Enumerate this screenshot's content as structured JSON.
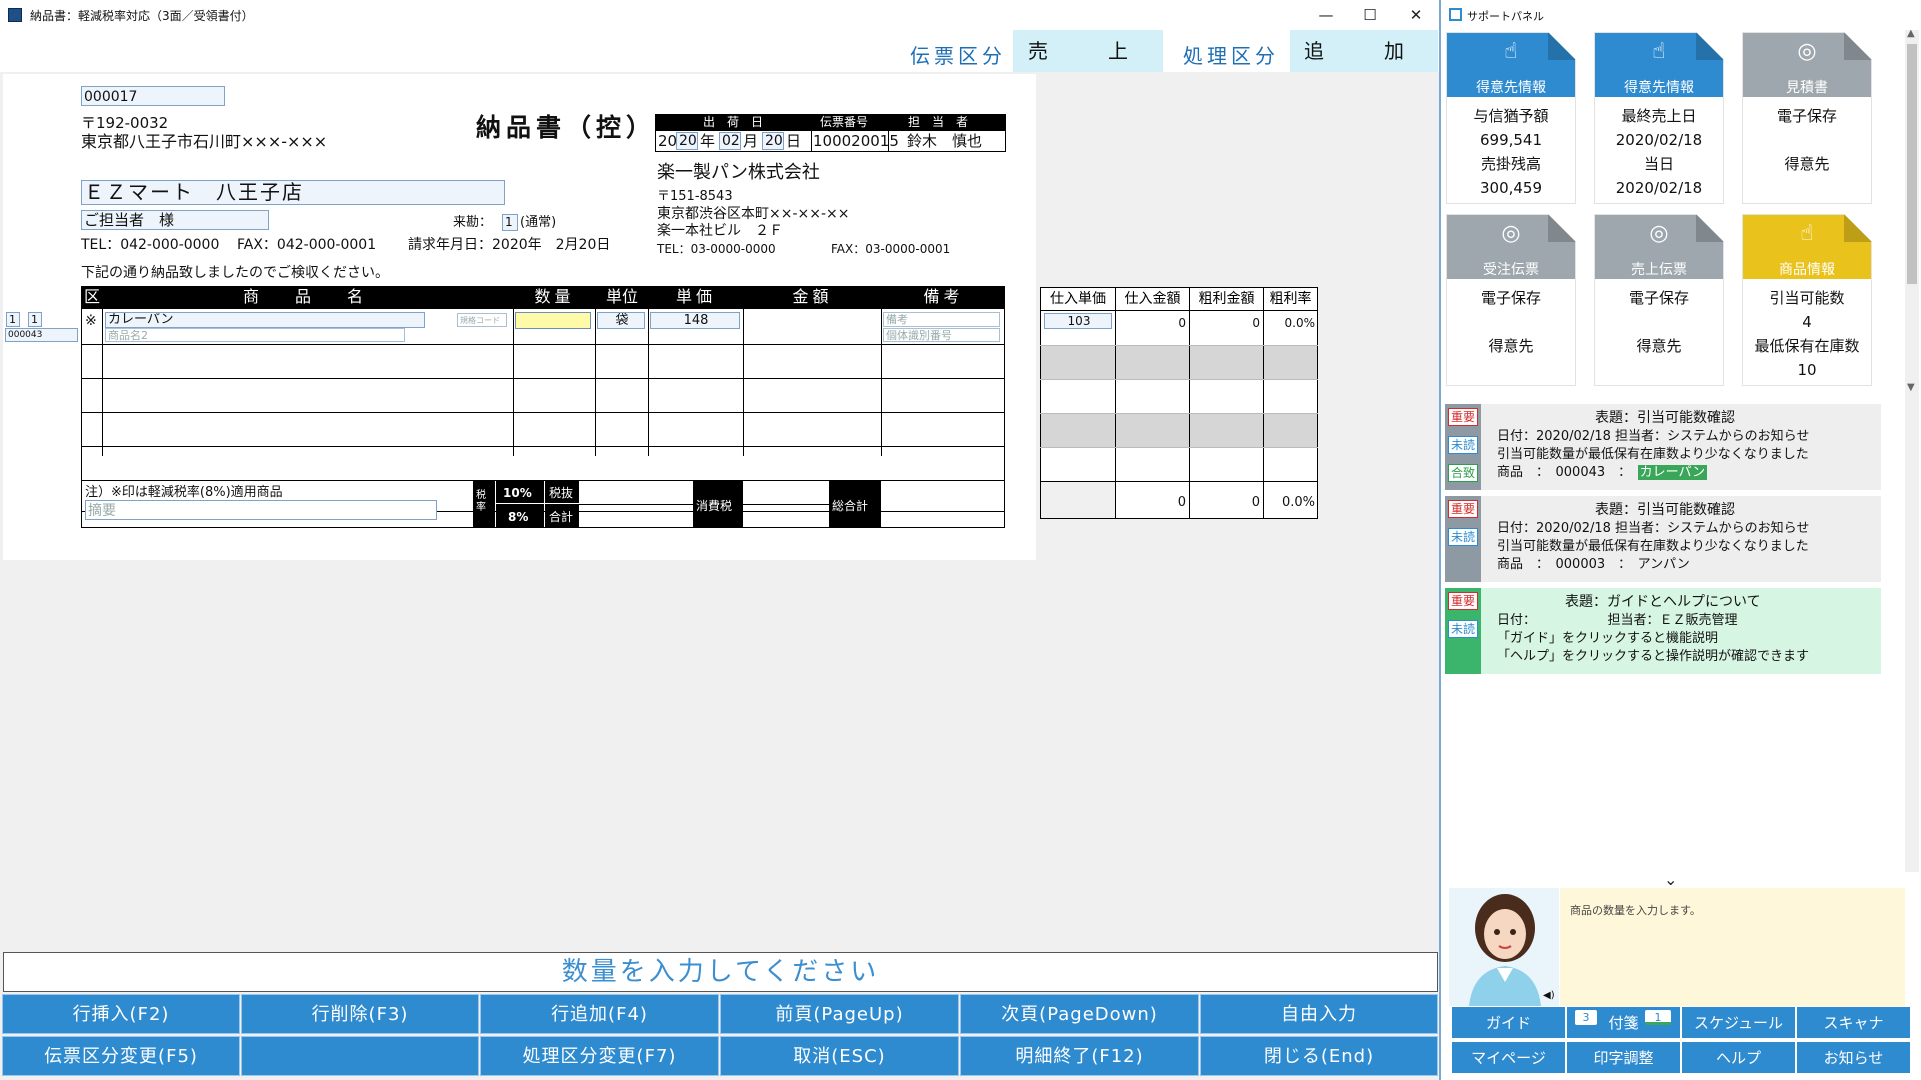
{
  "window": {
    "title": "納品書：軽減税率対応（3面／受領書付）",
    "minimize": "—",
    "maximize": "☐",
    "close": "✕"
  },
  "header": {
    "denpyo_label": "伝票区分",
    "denpyo_value": "売　上",
    "shori_label": "処理区分",
    "shori_value": "追　加"
  },
  "doc": {
    "customer_code": "000017",
    "zip": "〒192-0032",
    "address": "東京都八王子市石川町×××-×××",
    "title": "納品書（控）",
    "ship_date_label": "出　荷　日",
    "slip_no_label": "伝票番号",
    "staff_label": "担　当　者",
    "date_y1": "20",
    "date_y2": "20",
    "date_y_unit": "年",
    "date_m": "02",
    "date_m_unit": "月",
    "date_d": "20",
    "date_d_unit": "日",
    "slip_no": "100020015",
    "staff": "鈴木　慎也",
    "company": "楽一製パン株式会社",
    "company_zip": "〒151-8543",
    "company_address": "東京都渋谷区本町××-××-××",
    "company_building": "楽一本社ビル　２Ｆ",
    "company_tel": "TEL：03-0000-0000",
    "company_fax": "FAX：03-0000-0001",
    "customer_name": "ＥＺマート　八王子店",
    "contact": "ご担当者　様",
    "raikin_label": "来勘：",
    "raikin_value": "1",
    "raikin_text": "(通常)",
    "tel": "TEL：042-000-0000",
    "fax": "FAX：042-000-0001",
    "billing": "請求年月日：2020年　2月20日",
    "notice": "下記の通り納品致しましたのでご検収ください。"
  },
  "table": {
    "headers": [
      "区",
      "商　品　名",
      "数量",
      "単位",
      "単価",
      "金額",
      "備考"
    ],
    "row1": {
      "kubun": "※",
      "name": "カレーパン",
      "name2": "商品名2",
      "code_ph": "規格コード",
      "unit": "袋",
      "price": "148",
      "biko": "備考",
      "biko2": "個体識別番号"
    },
    "side_a": "1",
    "side_b": "1",
    "side_code": "000043",
    "note": "注）※印は軽減税率(8%)適用商品",
    "memo_ph": "摘要",
    "tax_label": "税率",
    "rate10": "10%",
    "rate8": "8%",
    "zeinuki": "税抜",
    "gokei": "合計",
    "shohizei": "消費税",
    "sougokei": "総合計"
  },
  "profit": {
    "headers": [
      "仕入単価",
      "仕入金額",
      "粗利金額",
      "粗利率"
    ],
    "row1": [
      "103",
      "0",
      "0",
      "0.0%"
    ],
    "totals": [
      "0",
      "0",
      "0.0%"
    ]
  },
  "message": "数量を入力してください",
  "fkeys": [
    "行挿入(F2)",
    "行削除(F3)",
    "行追加(F4)",
    "前頁(PageUp)",
    "次頁(PageDown)",
    "自由入力",
    "伝票区分変更(F5)",
    "",
    "処理区分変更(F7)",
    "取消(ESC)",
    "明細終了(F12)",
    "閉じる(End)"
  ],
  "panel": {
    "title": "サポートパネル",
    "cards": [
      {
        "title": "得意先情報",
        "icon": "hand-pointer-icon",
        "lines": [
          "与信猶予額",
          "699,541",
          "売掛残高",
          "300,459"
        ]
      },
      {
        "title": "得意先情報",
        "icon": "hand-pointer-icon",
        "lines": [
          "最終売上日",
          "2020/02/18",
          "当日",
          "2020/02/18"
        ]
      },
      {
        "title": "見積書",
        "icon": "fingerprint-icon",
        "lines": [
          "電子保存",
          "",
          "得意先",
          ""
        ]
      },
      {
        "title": "受注伝票",
        "icon": "fingerprint-icon",
        "lines": [
          "電子保存",
          "",
          "得意先",
          ""
        ]
      },
      {
        "title": "売上伝票",
        "icon": "fingerprint-icon",
        "lines": [
          "電子保存",
          "",
          "得意先",
          ""
        ]
      },
      {
        "title": "商品情報",
        "icon": "hand-pointer-icon",
        "lines": [
          "引当可能数",
          "4",
          "最低保有在庫数",
          "10"
        ]
      }
    ],
    "notes": [
      {
        "badges": [
          "重要",
          "未読",
          "合致"
        ],
        "title": "表題：引当可能数確認",
        "date": "日付：2020/02/18 担当者：システムからのお知らせ",
        "body": "引当可能数量が最低保有在庫数より少なくなりました",
        "item": "商品　：　000043　：　",
        "item_hl": "カレーパン"
      },
      {
        "badges": [
          "重要",
          "未読"
        ],
        "title": "表題：引当可能数確認",
        "date": "日付：2020/02/18 担当者：システムからのお知らせ",
        "body": "引当可能数量が最低保有在庫数より少なくなりました",
        "item": "商品　：　000003　：　アンパン",
        "item_hl": ""
      },
      {
        "badges": [
          "重要",
          "未読"
        ],
        "title": "表題：ガイドとヘルプについて",
        "date": "日付：　　　　　　担当者：ＥＺ販売管理",
        "body": "「ガイド」をクリックすると機能説明",
        "item": "「ヘルプ」をクリックすると操作説明が確認できます",
        "item_hl": ""
      }
    ],
    "assistant_msg": "商品の数量を入力します。",
    "buttons": [
      "ガイド",
      "付箋",
      "スケジュール",
      "スキャナ",
      "マイページ",
      "印字調整",
      "ヘルプ",
      "お知らせ"
    ],
    "fusen_badge1": "3",
    "fusen_badge2": "1"
  },
  "colors": {
    "accent": "#2e8bd0",
    "card_blue": "#2e8bd0",
    "card_gray": "#9ea7ad",
    "card_yellow": "#e9c21c",
    "highlight_green": "#3aa65a"
  }
}
